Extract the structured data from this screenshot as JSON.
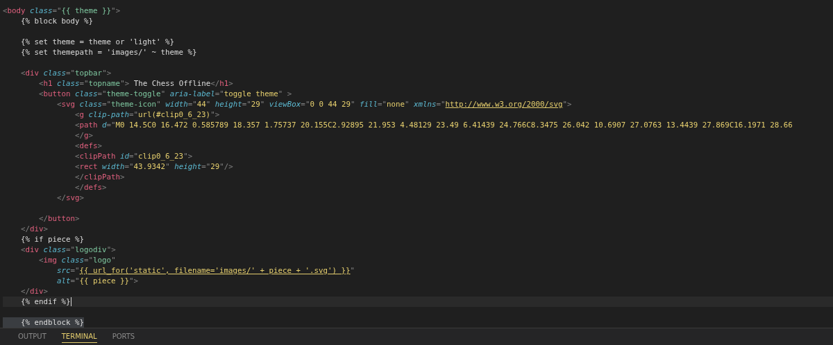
{
  "editor": {
    "lines": [
      {
        "kind": "code",
        "text": "<body class=\"{{ theme }}\">",
        "current": false,
        "highlighted": false
      },
      {
        "kind": "code",
        "text": "    {% block body %}",
        "current": false,
        "highlighted": false
      },
      {
        "kind": "blank"
      },
      {
        "kind": "code",
        "text": "    {% set theme = theme or 'light' %}",
        "current": false,
        "highlighted": false
      },
      {
        "kind": "code",
        "text": "    {% set themepath = 'images/' ~ theme %}",
        "current": false,
        "highlighted": false
      },
      {
        "kind": "blank"
      },
      {
        "kind": "code",
        "text": "    <div class=\"topbar\">",
        "current": false,
        "highlighted": false
      },
      {
        "kind": "code",
        "text": "        <h1 class=\"topname\"> The Chess Offline</h1>",
        "current": false,
        "highlighted": false
      },
      {
        "kind": "code",
        "text": "        <button class=\"theme-toggle\" aria-label=\"toggle theme\" >",
        "current": false,
        "highlighted": false
      },
      {
        "kind": "code",
        "text": "            <svg class=\"theme-icon\" width=\"44\" height=\"29\" viewBox=\"0 0 44 29\" fill=\"none\" xmlns=\"http://www.w3.org/2000/svg\">",
        "current": false,
        "highlighted": false
      },
      {
        "kind": "code",
        "text": "                <g clip-path=\"url(#clip0_6_23)\">",
        "current": false,
        "highlighted": false
      },
      {
        "kind": "code",
        "text": "                <path d=\"M0 14.5C0 16.472 0.585789 18.357 1.75737 20.155C2.92895 21.953 4.48129 23.49 6.41439 24.766C8.3475 26.042 10.6907 27.0763 13.4439 27.869C16.1971 28.66",
        "current": false,
        "highlighted": false
      },
      {
        "kind": "code",
        "text": "                </g>",
        "current": false,
        "highlighted": false
      },
      {
        "kind": "code",
        "text": "                <defs>",
        "current": false,
        "highlighted": false
      },
      {
        "kind": "code",
        "text": "                <clipPath id=\"clip0_6_23\">",
        "current": false,
        "highlighted": false
      },
      {
        "kind": "code",
        "text": "                <rect width=\"43.9342\" height=\"29\"/>",
        "current": false,
        "highlighted": false
      },
      {
        "kind": "code",
        "text": "                </clipPath>",
        "current": false,
        "highlighted": false
      },
      {
        "kind": "code",
        "text": "                </defs>",
        "current": false,
        "highlighted": false
      },
      {
        "kind": "code",
        "text": "            </svg>",
        "current": false,
        "highlighted": false
      },
      {
        "kind": "blank"
      },
      {
        "kind": "code",
        "text": "        </button>",
        "current": false,
        "highlighted": false
      },
      {
        "kind": "code",
        "text": "    </div>",
        "current": false,
        "highlighted": false
      },
      {
        "kind": "code",
        "text": "    {% if piece %}",
        "current": false,
        "highlighted": false
      },
      {
        "kind": "code",
        "text": "    <div class=\"logodiv\">",
        "current": false,
        "highlighted": false
      },
      {
        "kind": "code",
        "text": "        <img class=\"logo\"",
        "current": false,
        "highlighted": false
      },
      {
        "kind": "code",
        "text": "            src=\"{{ url_for('static', filename='images/' + piece + '.svg') }}\"",
        "current": false,
        "highlighted": false
      },
      {
        "kind": "code",
        "text": "            alt=\"{{ piece }}\">",
        "current": false,
        "highlighted": false
      },
      {
        "kind": "code",
        "text": "    </div>",
        "current": false,
        "highlighted": false
      },
      {
        "kind": "code",
        "text": "    {% endif %}",
        "current": true,
        "highlighted": false
      },
      {
        "kind": "blank"
      },
      {
        "kind": "code",
        "text": "    {% endblock %}",
        "current": false,
        "highlighted": true
      }
    ]
  },
  "panel": {
    "tabs": [
      {
        "label": "OUTPUT",
        "selected": false
      },
      {
        "label": "TERMINAL",
        "selected": true
      },
      {
        "label": "PORTS",
        "selected": false
      }
    ]
  }
}
